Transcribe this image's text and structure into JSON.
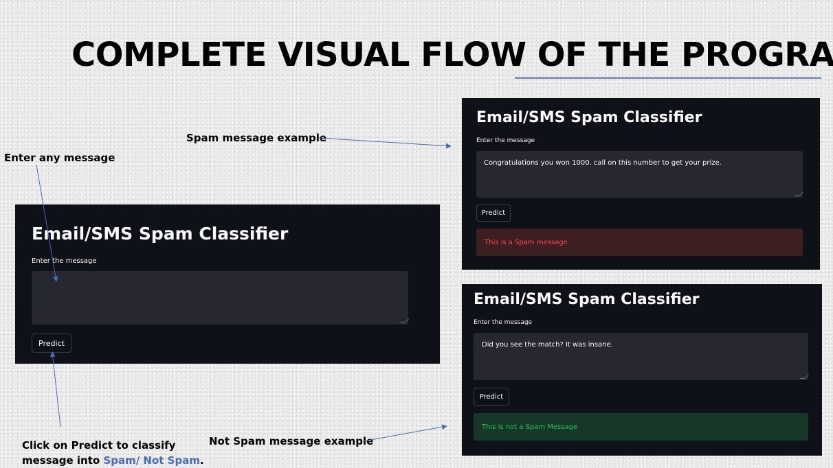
{
  "slide": {
    "title": "COMPLETE VISUAL FLOW OF THE PROGRAM"
  },
  "annotations": {
    "enter_message": "Enter any message",
    "spam_example": "Spam message example",
    "not_spam_example": "Not Spam message example",
    "click_predict_line1": "Click on Predict to classify",
    "click_predict_line2_prefix": "message into ",
    "click_predict_line2_highlight": "Spam/ Not Spam",
    "click_predict_line2_suffix": "."
  },
  "panels": {
    "main": {
      "title": "Email/SMS Spam Classifier",
      "input_label": "Enter the message",
      "input_value": "",
      "button_label": "Predict"
    },
    "spam": {
      "title": "Email/SMS Spam Classifier",
      "input_label": "Enter the message",
      "input_value": "Congratulations you won 1000. call on this number to get your prize.",
      "button_label": "Predict",
      "result": "This is a Spam message"
    },
    "ham": {
      "title": "Email/SMS Spam Classifier",
      "input_label": "Enter the message",
      "input_value": "Did you see the match? It was insane.",
      "button_label": "Predict",
      "result": "This is not a Spam Message"
    }
  },
  "colors": {
    "panel_bg": "#0e1117",
    "input_bg": "#262730",
    "spam_bg": "#3d1e21",
    "spam_text": "#ff4b4b",
    "ham_bg": "#173828",
    "ham_text": "#21c354",
    "accent": "#4a6cb3"
  }
}
